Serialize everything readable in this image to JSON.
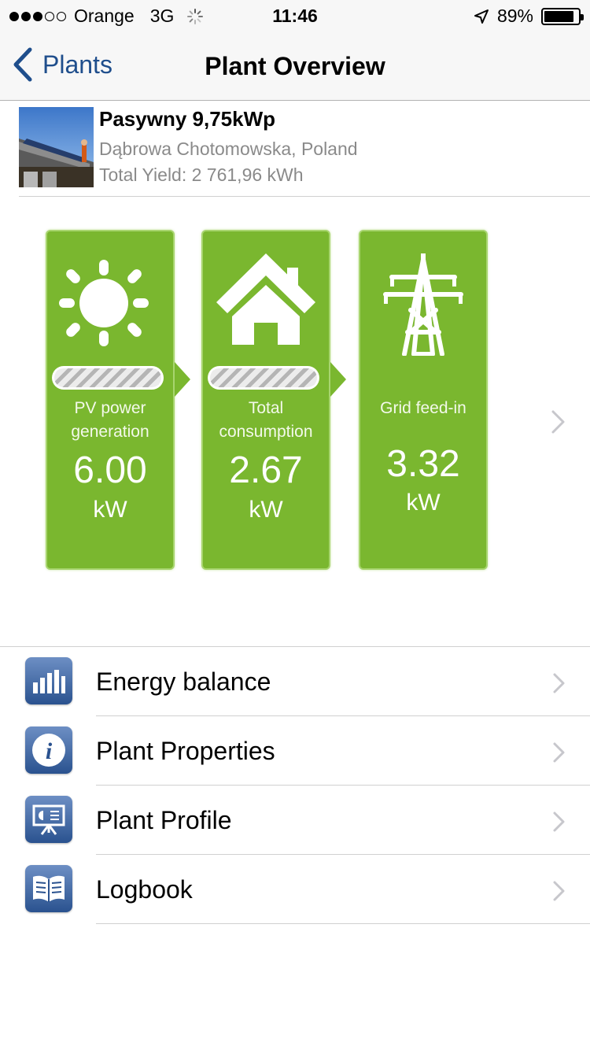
{
  "status_bar": {
    "carrier": "Orange",
    "network": "3G",
    "time": "11:46",
    "battery": "89%",
    "battery_level": 0.89,
    "signal_bars_filled": 3,
    "signal_bars_total": 5
  },
  "nav": {
    "back_label": "Plants",
    "title": "Plant Overview"
  },
  "plant": {
    "name": "Pasywny 9,75kWp",
    "location": "Dąbrowa Chotomowska, Poland",
    "total_yield": "Total Yield: 2 761,96 kWh"
  },
  "flow": {
    "accent_color": "#7ab72f",
    "cards": [
      {
        "icon": "sun-icon",
        "label_line1": "PV power",
        "label_line2": "generation",
        "value": "6.00",
        "unit": "kW"
      },
      {
        "icon": "house-icon",
        "label_line1": "Total",
        "label_line2": "consumption",
        "value": "2.67",
        "unit": "kW"
      },
      {
        "icon": "power-pylon-icon",
        "label_line1": "Grid feed-in",
        "label_line2": "",
        "value": "3.32",
        "unit": "kW"
      }
    ]
  },
  "menu": {
    "icon_color": "#2a528f",
    "items": [
      {
        "icon": "bar-chart-icon",
        "label": "Energy balance"
      },
      {
        "icon": "info-icon",
        "label": "Plant Properties"
      },
      {
        "icon": "presentation-icon",
        "label": "Plant Profile"
      },
      {
        "icon": "book-icon",
        "label": "Logbook"
      }
    ]
  }
}
